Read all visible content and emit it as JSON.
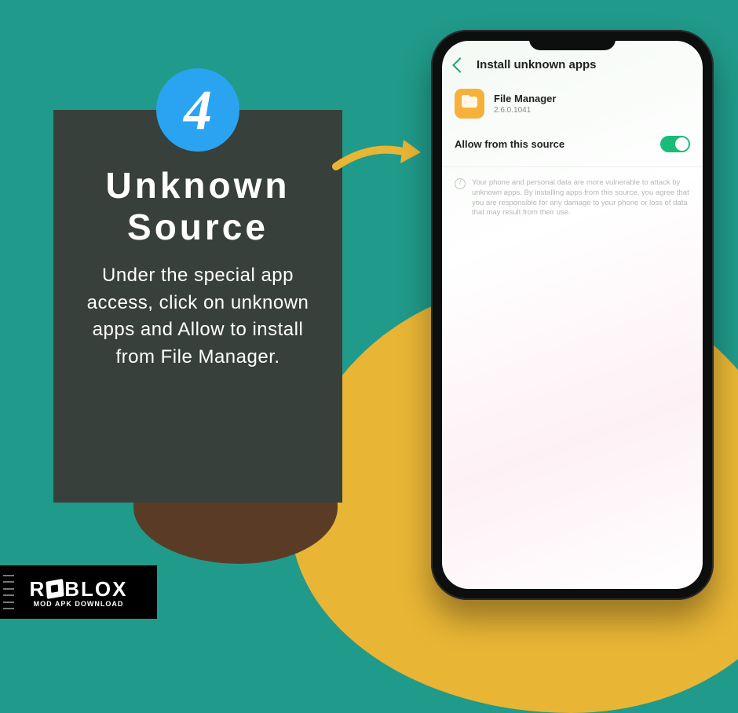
{
  "badge": {
    "number": "4"
  },
  "card": {
    "title": "Unknown Source",
    "description": "Under the special app access, click on unknown apps and Allow to install from File Manager."
  },
  "phone": {
    "header_title": "Install unknown apps",
    "app": {
      "name": "File Manager",
      "version": "2.6.0.1041"
    },
    "allow_label": "Allow from this source",
    "toggle_on": true,
    "warning": "Your phone and personal data are more vulnerable to attack by unknown apps. By installing apps from this source, you agree that you are responsible for any damage to your phone or loss of data that may result from their use."
  },
  "logo": {
    "primary_left": "R",
    "primary_right": "BLOX",
    "subtitle": "MOD APK DOWNLOAD"
  }
}
